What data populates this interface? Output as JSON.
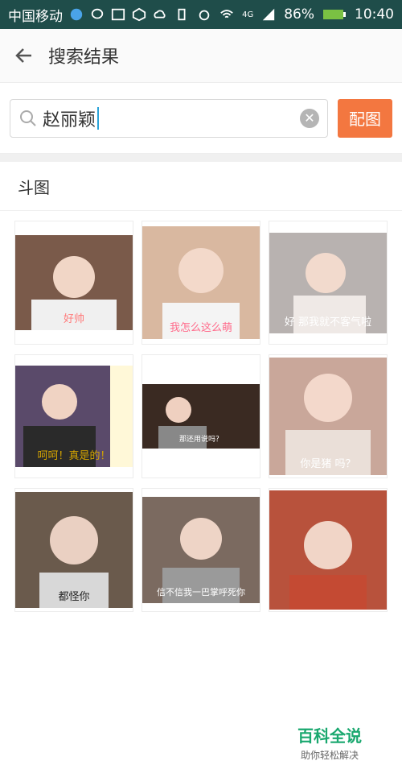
{
  "status_bar": {
    "carrier": "中国移动",
    "network": "4G",
    "battery": "86%",
    "time": "10:40"
  },
  "header": {
    "title": "搜索结果"
  },
  "search": {
    "query": "赵丽颖",
    "button_label": "配图"
  },
  "section": {
    "title": "斗图"
  },
  "images": [
    {
      "caption": "好帅",
      "bg": "#7a5a4a",
      "cap_color": "#ff7a7a"
    },
    {
      "caption": "我怎么这么萌",
      "bg": "#d9b8a0",
      "cap_color": "#ff6a8a"
    },
    {
      "caption": "好 那我就不客气啦",
      "bg": "#b8b2b0",
      "cap_color": "#ffffff"
    },
    {
      "caption": "呵呵！真是的！",
      "bg": "#5a4a6a",
      "cap_color": "#d4a400"
    },
    {
      "caption": "那还用说吗？",
      "bg": "#3a2a22",
      "cap_color": "#ffffff"
    },
    {
      "caption": "你是猪 吗？",
      "bg": "#c9a79a",
      "cap_color": "#ffffff"
    },
    {
      "caption": "都怪你",
      "bg": "#6a5a4c",
      "cap_color": "#222222"
    },
    {
      "caption": "信不信我一巴掌呼死你",
      "bg": "#7b6a60",
      "cap_color": "#ffffff"
    },
    {
      "caption": "",
      "bg": "#b8523c",
      "cap_color": "#ffffff"
    }
  ],
  "watermark": {
    "title": "百科全说",
    "subtitle": "助你轻松解决"
  }
}
